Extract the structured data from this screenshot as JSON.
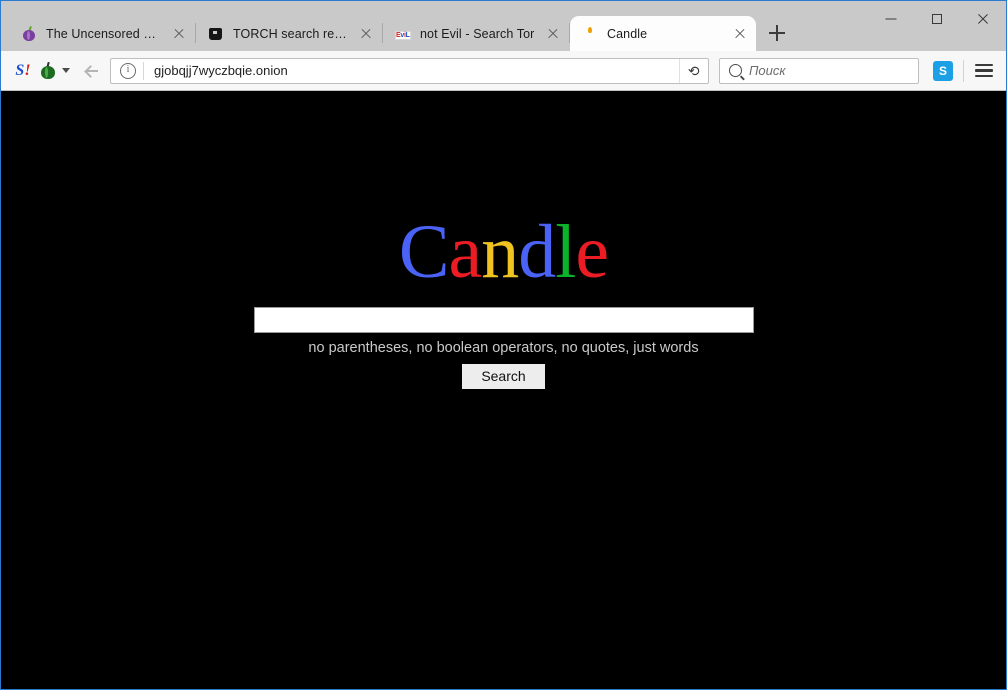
{
  "window": {
    "controls": {
      "minimize": "minimize-window",
      "maximize": "maximize-window",
      "close": "close-window"
    }
  },
  "tabstrip": {
    "tabs": [
      {
        "title": "The Uncensored Hidde...",
        "favicon": "onion-icon",
        "active": false
      },
      {
        "title": "TORCH search results f...",
        "favicon": "torch-icon",
        "active": false
      },
      {
        "title": "not Evil - Search Tor",
        "favicon": "notevil-icon",
        "active": false
      },
      {
        "title": "Candle",
        "favicon": "candle-icon",
        "active": true
      }
    ],
    "new_tab_label": "+"
  },
  "toolbar": {
    "extension_s_label": "S",
    "extension_s_bang": "!",
    "onion_button": "tor-onion-button",
    "back_button": "back-icon",
    "site_info": "info-icon",
    "url": "gjobqjj7wyczbqie.onion",
    "reload": "⟳",
    "search": {
      "placeholder": "Поиск",
      "value": ""
    },
    "skype_label": "S",
    "menu": "hamburger-menu"
  },
  "page": {
    "background": "#000000",
    "logo": {
      "letters": [
        {
          "char": "C",
          "color": "#4a62f5"
        },
        {
          "char": "a",
          "color": "#ec1c24"
        },
        {
          "char": "n",
          "color": "#f0c420"
        },
        {
          "char": "d",
          "color": "#4a62f5"
        },
        {
          "char": "l",
          "color": "#0bb32a"
        },
        {
          "char": "e",
          "color": "#ec1c24"
        }
      ],
      "text": "Candle"
    },
    "search_input": {
      "value": "",
      "placeholder": ""
    },
    "hint": "no parentheses, no boolean operators, no quotes, just words",
    "search_button": "Search"
  }
}
